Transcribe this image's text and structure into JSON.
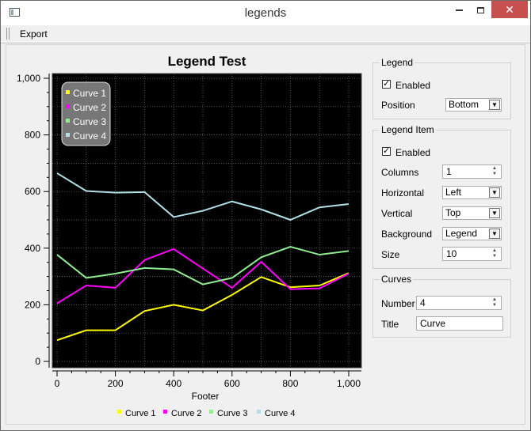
{
  "window": {
    "title": "legends"
  },
  "toolbar": {
    "export_label": "Export"
  },
  "legend_group": {
    "title": "Legend",
    "enabled_label": "Enabled",
    "enabled": true,
    "position_label": "Position",
    "position_value": "Bottom"
  },
  "legend_item_group": {
    "title": "Legend Item",
    "enabled_label": "Enabled",
    "enabled": true,
    "columns_label": "Columns",
    "columns_value": "1",
    "horizontal_label": "Horizontal",
    "horizontal_value": "Left",
    "vertical_label": "Vertical",
    "vertical_value": "Top",
    "background_label": "Background",
    "background_value": "Legend",
    "size_label": "Size",
    "size_value": "10"
  },
  "curves_group": {
    "title": "Curves",
    "number_label": "Number",
    "number_value": "4",
    "title_label": "Title",
    "title_value": "Curve"
  },
  "chart_data": {
    "type": "line",
    "title": "Legend Test",
    "xlabel": "Footer",
    "ylabel": "",
    "xlim": [
      0,
      1000
    ],
    "ylim": [
      0,
      1000
    ],
    "xticks": [
      "0",
      "200",
      "400",
      "600",
      "800",
      "1,000"
    ],
    "yticks": [
      "0",
      "200",
      "400",
      "600",
      "800",
      "1,000"
    ],
    "grid": true,
    "background": "#000000",
    "legend_inside": "top-left",
    "legend_outside": "bottom",
    "x": [
      0,
      100,
      200,
      300,
      400,
      500,
      600,
      700,
      800,
      900,
      1000
    ],
    "series": [
      {
        "name": "Curve 1",
        "color": "#ffff00",
        "values": [
          75,
          110,
          110,
          178,
          200,
          180,
          235,
          298,
          262,
          268,
          312
        ]
      },
      {
        "name": "Curve 2",
        "color": "#ff00ff",
        "values": [
          205,
          268,
          260,
          358,
          397,
          328,
          260,
          352,
          255,
          258,
          310
        ]
      },
      {
        "name": "Curve 3",
        "color": "#90ee90",
        "values": [
          377,
          295,
          310,
          330,
          325,
          272,
          295,
          368,
          405,
          377,
          390
        ]
      },
      {
        "name": "Curve 4",
        "color": "#b0e0e6",
        "values": [
          665,
          602,
          596,
          598,
          510,
          532,
          565,
          537,
          500,
          544,
          556
        ]
      }
    ]
  }
}
